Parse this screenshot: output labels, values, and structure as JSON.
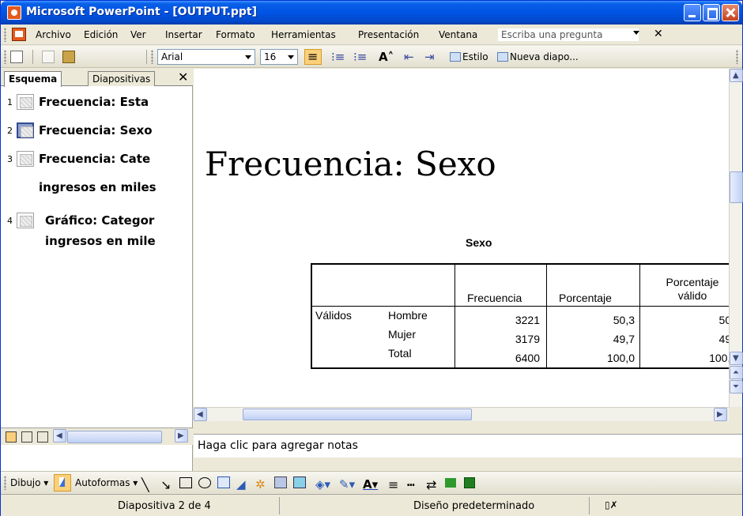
{
  "window": {
    "title": "Microsoft PowerPoint - [OUTPUT.ppt]"
  },
  "menu": {
    "items": [
      "Archivo",
      "Edición",
      "Ver",
      "Insertar",
      "Formato",
      "Herramientas",
      "Presentación",
      "Ventana"
    ],
    "ask_placeholder": "Escriba una pregunta"
  },
  "toolbar": {
    "font": "Arial",
    "font_size": "16",
    "estilo_label": "Estilo",
    "nueva_label": "Nueva diapo..."
  },
  "left_pane": {
    "tabs": [
      "Esquema",
      "Diapositivas"
    ],
    "outline": [
      {
        "num": "1",
        "text": "Frecuencia: Esta",
        "selected": false
      },
      {
        "num": "2",
        "text": "Frecuencia: Sexo",
        "selected": true
      },
      {
        "num": "3",
        "text": "Frecuencia: Cate",
        "selected": false,
        "continuation": "ingresos en miles"
      },
      {
        "num": "4",
        "text": "Gráfico: Categor",
        "selected": false,
        "continuation": "ingresos en mile"
      }
    ]
  },
  "slide": {
    "title": "Frecuencia: Sexo",
    "table": {
      "title": "Sexo",
      "headers": [
        "Frecuencia",
        "Porcentaje",
        "Porcentaje válido"
      ],
      "group_label": "Válidos",
      "rows": [
        {
          "label": "Hombre",
          "frecuencia": "3221",
          "porcentaje": "50,3",
          "valido": "50,"
        },
        {
          "label": "Mujer",
          "frecuencia": "3179",
          "porcentaje": "49,7",
          "valido": "49,"
        },
        {
          "label": "Total",
          "frecuencia": "6400",
          "porcentaje": "100,0",
          "valido": "100,("
        }
      ]
    }
  },
  "notes": {
    "placeholder": "Haga clic para agregar notas"
  },
  "drawing": {
    "dibujo_label": "Dibujo",
    "autoformas_label": "Autoformas"
  },
  "status": {
    "slide_info": "Diapositiva 2 de 4",
    "design": "Diseño predeterminado"
  },
  "colors": {
    "titlebar": "#0054e3",
    "selected_button": "#fbd07a",
    "chrome": "#ece9d8"
  }
}
